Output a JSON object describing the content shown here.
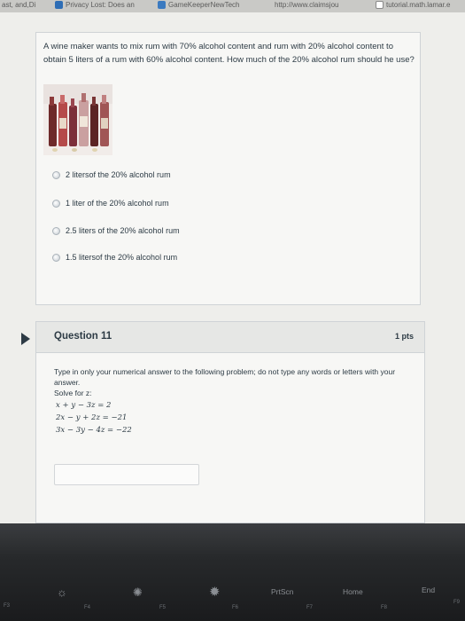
{
  "bookmarks": [
    {
      "label": "ast, and,Di",
      "color": "#7a7a7a"
    },
    {
      "label": "Privacy Lost: Does an",
      "color": "#2e6db5"
    },
    {
      "label": "GameKeeperNewTech",
      "color": "#3b7ac0"
    },
    {
      "label": "http://www.claimsjou",
      "color": "#8a8a8a"
    },
    {
      "label": "tutorial.math.lamar.e",
      "color": "#ffffff"
    }
  ],
  "question10": {
    "text": "A wine maker wants to mix rum with 70% alcohol content and rum with 20% alcohol content to obtain 5 liters of a rum with 60% alcohol content. How much of the 20% alcohol rum should he use?",
    "answers": [
      "2 litersof the 20% alcohol rum",
      "1 liter of the 20% alcohol rum",
      "2.5 liters of the 20% alcohol rum",
      "1.5 litersof the 20% alcohol rum"
    ]
  },
  "question11": {
    "title": "Question 11",
    "points": "1 pts",
    "instructions": "Type in only your numerical answer to the following problem; do not type any words or letters with your answer.",
    "solve_for": "Solve for z:",
    "equations": [
      "x + y − 3z = 2",
      "2x − y + 2z = −21",
      "3x − 3y − 4z = −22"
    ],
    "answer_value": ""
  },
  "keyboard": {
    "keys": [
      {
        "label": "F3",
        "icon": "keyboard-backlight-icon"
      },
      {
        "label": "F4",
        "icon": "brightness-down-icon"
      },
      {
        "label": "F5",
        "icon": "brightness-low-icon"
      },
      {
        "label": "F6",
        "icon": "brightness-up-icon"
      },
      {
        "label": "F7",
        "text": "PrtScn"
      },
      {
        "label": "F8",
        "text": "Home"
      },
      {
        "label": "F9",
        "text": "End"
      }
    ]
  }
}
